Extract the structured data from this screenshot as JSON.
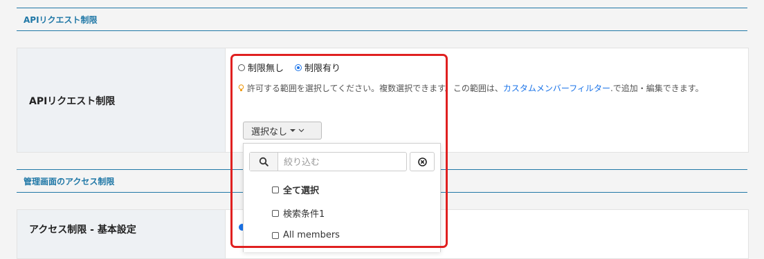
{
  "sections": {
    "api_header": "APIリクエスト制限",
    "admin_header": "管理画面のアクセス制限"
  },
  "api_row": {
    "label": "APIリクエスト制限",
    "radio_no_limit": "制限無し",
    "radio_limit": "制限有り",
    "selected": "制限有り",
    "help_text_1": "許可する範囲を選択してください。複数選択できます。この範囲は、",
    "help_link": "カスタムメンバーフィルター",
    "help_text_2": ".で追加・編集できます。",
    "dropdown_label": "選択なし"
  },
  "dropdown": {
    "search_placeholder": "絞り込む",
    "options": [
      {
        "label": "全て選択",
        "checked": false,
        "bold": true
      },
      {
        "label": "検索条件1",
        "checked": false,
        "bold": false
      },
      {
        "label": "All members",
        "checked": false,
        "bold": false
      }
    ]
  },
  "access_row": {
    "label": "アクセス制限 - 基本設定"
  },
  "colors": {
    "accent": "#1f77a6",
    "highlight": "#e02020",
    "link": "#1a73e8"
  },
  "icons": {
    "search": "search-icon",
    "clear": "clear-icon",
    "bulb": "lightbulb-icon",
    "caret": "caret-down-icon"
  }
}
